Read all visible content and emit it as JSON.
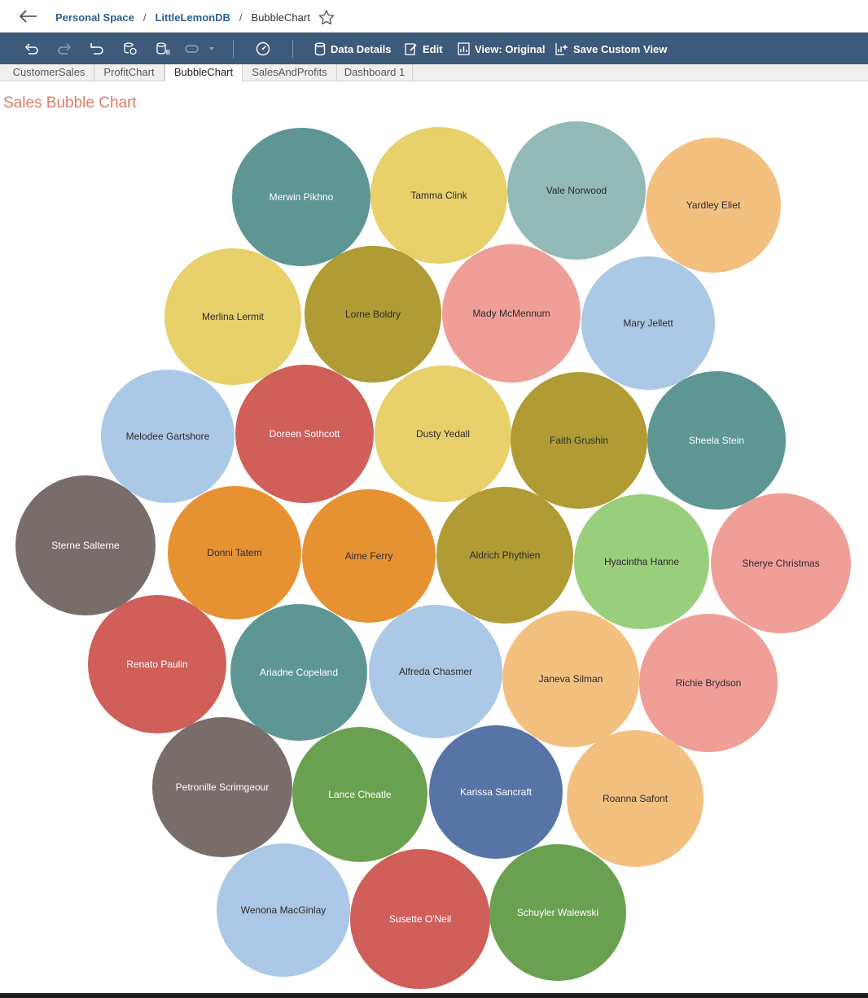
{
  "breadcrumb": {
    "items": [
      "Personal Space",
      "LittleLemonDB"
    ],
    "current": "BubbleChart",
    "separator": "/"
  },
  "toolbar": {
    "data_details": "Data Details",
    "edit": "Edit",
    "view_original": "View: Original",
    "save_custom_view": "Save Custom View"
  },
  "tabs": [
    "CustomerSales",
    "ProfitChart",
    "BubbleChart",
    "SalesAndProfits",
    "Dashboard 1"
  ],
  "active_tab": "BubbleChart",
  "sheet": {
    "title": "Sales Bubble Chart"
  },
  "colors": {
    "toolbar_bg": "#3d5a7a",
    "title": "#e07b65",
    "link": "#2e5f8f"
  },
  "chart_data": {
    "type": "bubble",
    "title": "Sales Bubble Chart",
    "bubbles": [
      {
        "label": "Merwin Pikhno",
        "color": "#5e9693"
      },
      {
        "label": "Tamma Clink",
        "color": "#e8d06a"
      },
      {
        "label": "Vale Norwood",
        "color": "#93bab6"
      },
      {
        "label": "Yardley Eliet",
        "color": "#f4c080"
      },
      {
        "label": "Merlina Lermit",
        "color": "#e8d06a"
      },
      {
        "label": "Lorne Boldry",
        "color": "#b19b35"
      },
      {
        "label": "Mady McMennum",
        "color": "#f09f98"
      },
      {
        "label": "Mary Jellett",
        "color": "#abc8e6"
      },
      {
        "label": "Melodee Gartshore",
        "color": "#abc8e6"
      },
      {
        "label": "Doreen Sothcott",
        "color": "#d05f5a"
      },
      {
        "label": "Dusty Yedall",
        "color": "#e8d06a"
      },
      {
        "label": "Faith Grushin",
        "color": "#b19b35"
      },
      {
        "label": "Sheela Stein",
        "color": "#5e9693"
      },
      {
        "label": "Sterne Salterne",
        "color": "#786d6b"
      },
      {
        "label": "Donni Tatem",
        "color": "#e69233"
      },
      {
        "label": "Aime Ferry",
        "color": "#e69233"
      },
      {
        "label": "Aldrich Phythien",
        "color": "#b19b35"
      },
      {
        "label": "Hyacintha Hanne",
        "color": "#99ce7d"
      },
      {
        "label": "Sherye Christmas",
        "color": "#f09f98"
      },
      {
        "label": "Renato Paulin",
        "color": "#d05f5a"
      },
      {
        "label": "Ariadne Copeland",
        "color": "#5e9693"
      },
      {
        "label": "Alfreda Chasmer",
        "color": "#abc8e6"
      },
      {
        "label": "Janeva Silman",
        "color": "#f4c080"
      },
      {
        "label": "Richie Brydson",
        "color": "#f09f98"
      },
      {
        "label": "Petronille Scrimgeour",
        "color": "#786d6b"
      },
      {
        "label": "Lance Cheatle",
        "color": "#6aa150"
      },
      {
        "label": "Karissa Sancraft",
        "color": "#5675a6"
      },
      {
        "label": "Roanna Safont",
        "color": "#f4c080"
      },
      {
        "label": "Wenona MacGinlay",
        "color": "#abc8e6"
      },
      {
        "label": "Susette O'Neil",
        "color": "#d05f5a"
      },
      {
        "label": "Schuyler Walewski",
        "color": "#6aa150"
      }
    ]
  }
}
